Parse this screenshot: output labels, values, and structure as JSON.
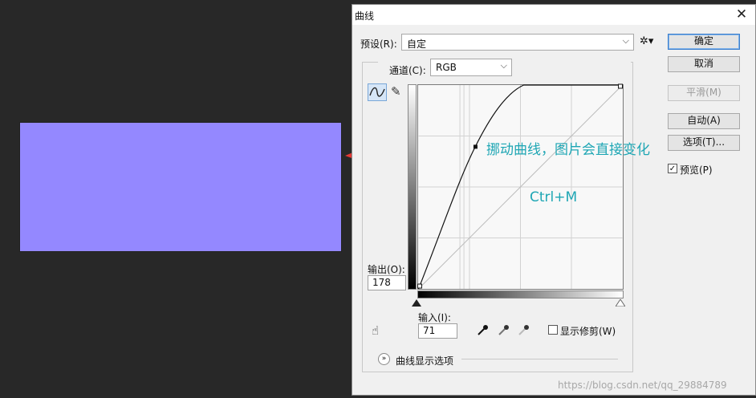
{
  "dialog": {
    "title": "曲线",
    "close_glyph": "✕",
    "preset": {
      "label": "预设(R):",
      "value": "自定"
    },
    "channel": {
      "label": "通道(C):",
      "value": "RGB"
    },
    "output": {
      "label": "输出(O):",
      "value": "178"
    },
    "input": {
      "label": "输入(I):",
      "value": "71"
    },
    "buttons": {
      "ok": "确定",
      "cancel": "取消",
      "smooth": "平滑(M)",
      "auto": "自动(A)",
      "options": "选项(T)..."
    },
    "preview": {
      "label": "预览(P)",
      "checked": true
    },
    "show_clipping": {
      "label": "显示修剪(W)",
      "checked": false
    },
    "display_options": "曲线显示选项"
  },
  "annotations": {
    "callout": "挪动曲线，图片会直接变化",
    "shortcut": "Ctrl+M"
  },
  "watermark": "https://blog.csdn.net/qq_29884789",
  "colors": {
    "swatch": "#9488ff",
    "arrow": "#e53935",
    "annotation": "#1ea6b4",
    "background": "#282828"
  }
}
